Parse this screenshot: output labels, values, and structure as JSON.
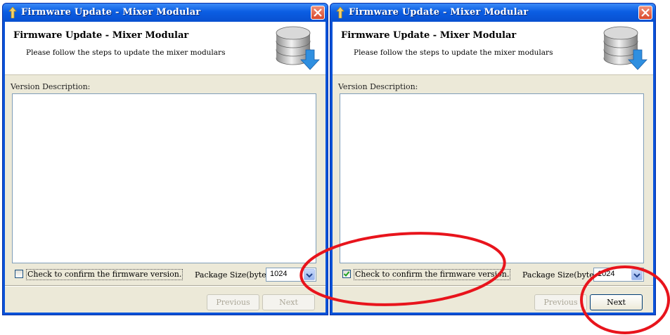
{
  "colors": {
    "titlebar": "#0b5ee3",
    "annotation": "#e8141c",
    "client_bg": "#ece9d8"
  },
  "windows": [
    {
      "title": "Firmware Update - Mixer Modular",
      "header_title": "Firmware Update - Mixer Modular",
      "header_subtitle": "Please follow the steps to update the mixer modulars",
      "version_label": "Version Description:",
      "confirm_label": "Check to confirm the firmware version.",
      "confirm_checked": false,
      "package_label": "Package Size(byte):",
      "package_value": "1024",
      "previous_label": "Previous",
      "next_label": "Next",
      "next_enabled": false
    },
    {
      "title": "Firmware Update - Mixer Modular",
      "header_title": "Firmware Update - Mixer Modular",
      "header_subtitle": "Please follow the steps to update the mixer modulars",
      "version_label": "Version Description:",
      "confirm_label": "Check to confirm the firmware version.",
      "confirm_checked": true,
      "package_label": "Package Size(byte):",
      "package_value": "1024",
      "previous_label": "Previous",
      "next_label": "Next",
      "next_enabled": true
    }
  ],
  "icons": {
    "title": "update-arrow-icon",
    "close": "close-icon",
    "header": "database-download-icon",
    "dropdown": "chevron-down-icon",
    "check": "checkmark-icon"
  }
}
